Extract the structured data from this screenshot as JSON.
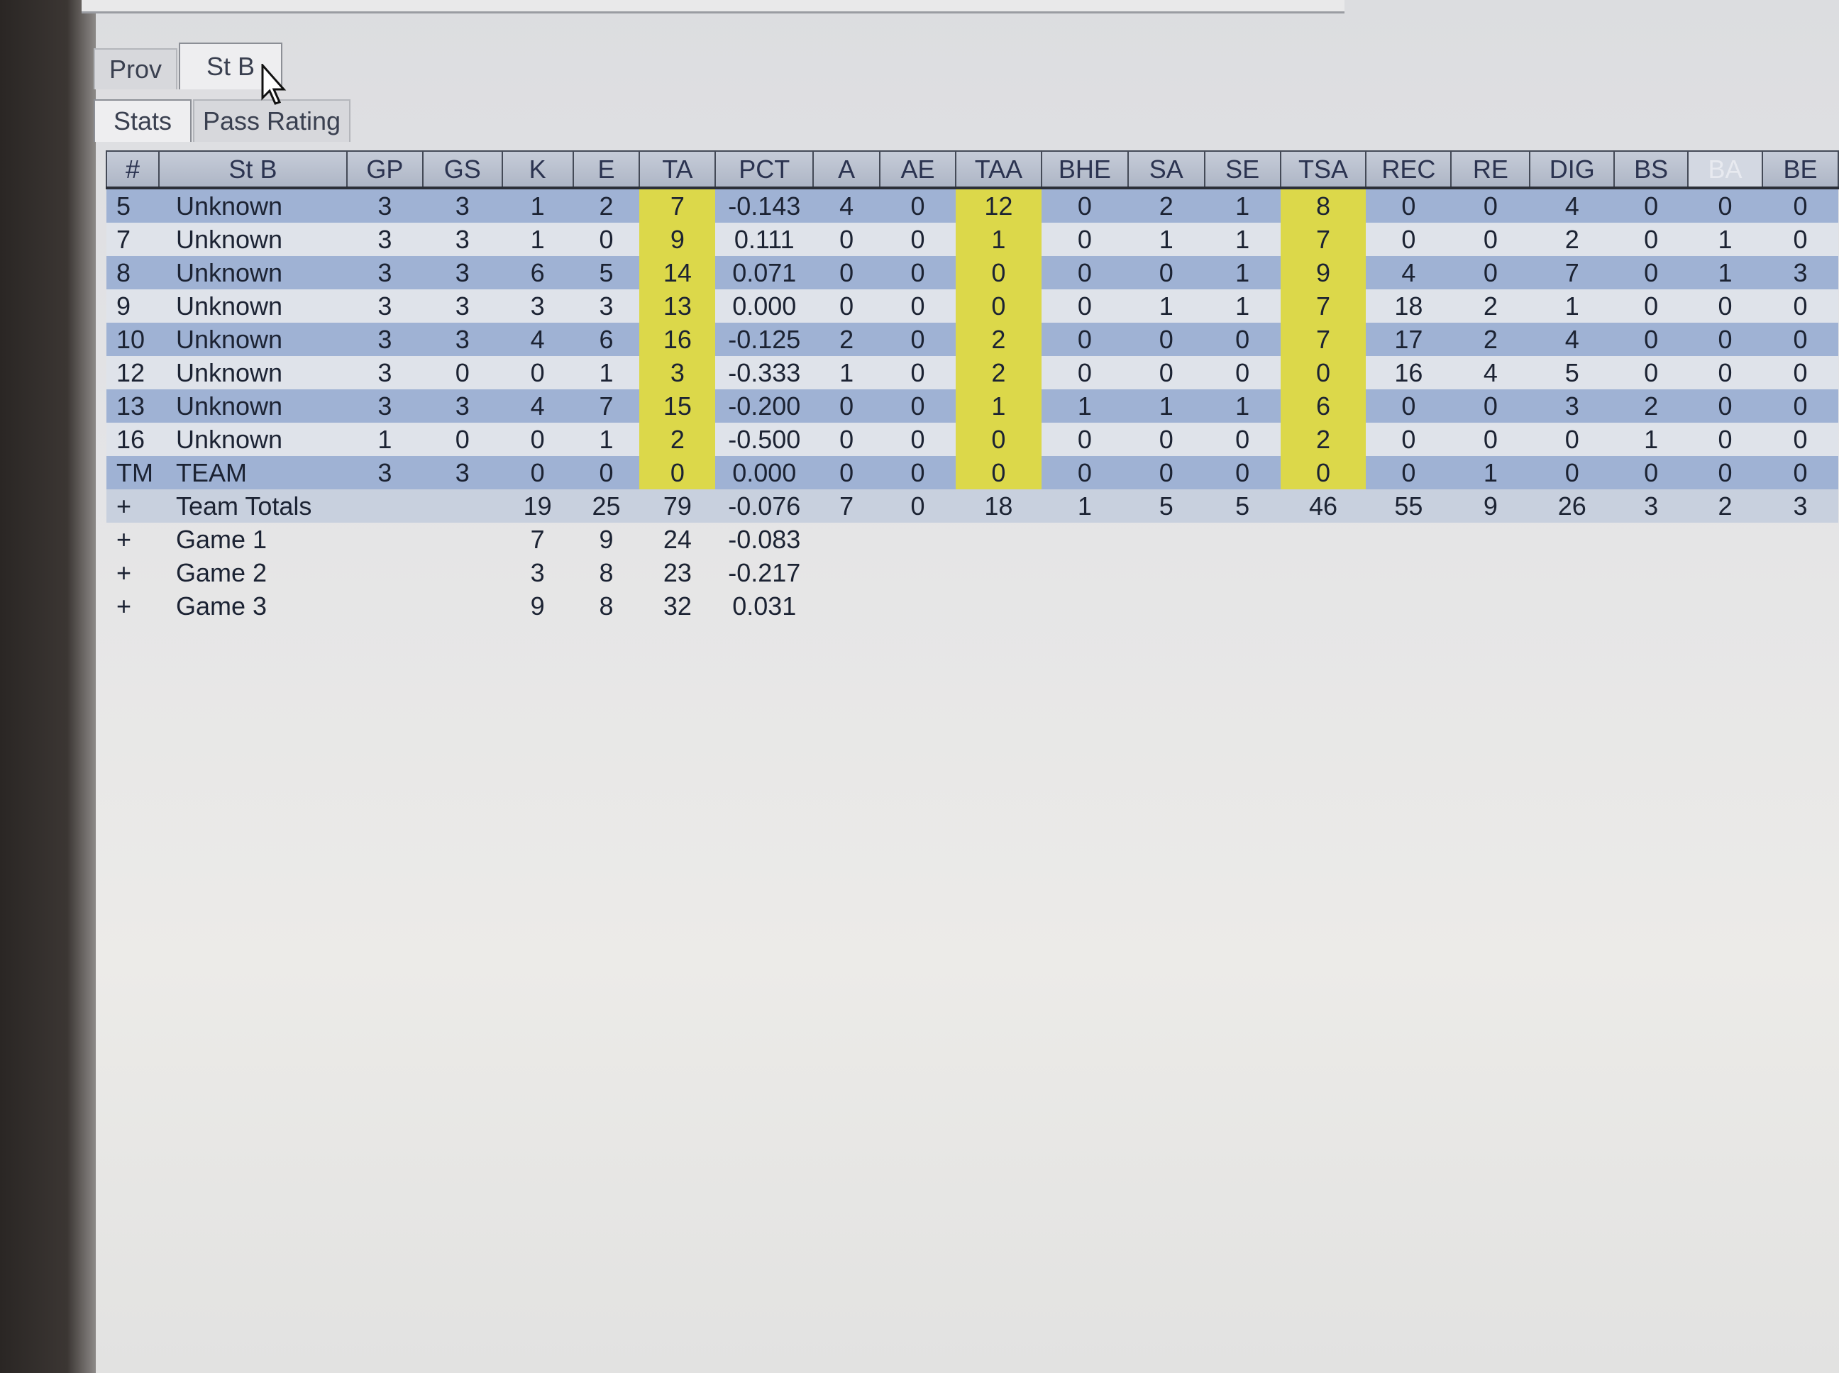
{
  "tabs_top": [
    {
      "label": "Prov",
      "active": false
    },
    {
      "label": "St B",
      "active": true
    }
  ],
  "tabs_sub": [
    {
      "label": "Stats",
      "active": true
    },
    {
      "label": "Pass Rating",
      "active": false
    }
  ],
  "colors": {
    "odd_row": "#9fb2d4",
    "even_row": "#dfe3ea",
    "highlight_column": "#dcd84a"
  },
  "table": {
    "columns": [
      "#",
      "St B",
      "GP",
      "GS",
      "K",
      "E",
      "TA",
      "PCT",
      "A",
      "AE",
      "TAA",
      "BHE",
      "SA",
      "SE",
      "TSA",
      "REC",
      "RE",
      "DIG",
      "BS",
      "BA",
      "BE"
    ],
    "highlight_columns": [
      "TA",
      "TAA",
      "TSA"
    ],
    "rows": [
      [
        "5",
        "Unknown",
        "3",
        "3",
        "1",
        "2",
        "7",
        "-0.143",
        "4",
        "0",
        "12",
        "0",
        "2",
        "1",
        "8",
        "0",
        "0",
        "4",
        "0",
        "0",
        "0"
      ],
      [
        "7",
        "Unknown",
        "3",
        "3",
        "1",
        "0",
        "9",
        "0.111",
        "0",
        "0",
        "1",
        "0",
        "1",
        "1",
        "7",
        "0",
        "0",
        "2",
        "0",
        "1",
        "0"
      ],
      [
        "8",
        "Unknown",
        "3",
        "3",
        "6",
        "5",
        "14",
        "0.071",
        "0",
        "0",
        "0",
        "0",
        "0",
        "1",
        "9",
        "4",
        "0",
        "7",
        "0",
        "1",
        "3"
      ],
      [
        "9",
        "Unknown",
        "3",
        "3",
        "3",
        "3",
        "13",
        "0.000",
        "0",
        "0",
        "0",
        "0",
        "1",
        "1",
        "7",
        "18",
        "2",
        "1",
        "0",
        "0",
        "0"
      ],
      [
        "10",
        "Unknown",
        "3",
        "3",
        "4",
        "6",
        "16",
        "-0.125",
        "2",
        "0",
        "2",
        "0",
        "0",
        "0",
        "7",
        "17",
        "2",
        "4",
        "0",
        "0",
        "0"
      ],
      [
        "12",
        "Unknown",
        "3",
        "0",
        "0",
        "1",
        "3",
        "-0.333",
        "1",
        "0",
        "2",
        "0",
        "0",
        "0",
        "0",
        "16",
        "4",
        "5",
        "0",
        "0",
        "0"
      ],
      [
        "13",
        "Unknown",
        "3",
        "3",
        "4",
        "7",
        "15",
        "-0.200",
        "0",
        "0",
        "1",
        "1",
        "1",
        "1",
        "6",
        "0",
        "0",
        "3",
        "2",
        "0",
        "0"
      ],
      [
        "16",
        "Unknown",
        "1",
        "0",
        "0",
        "1",
        "2",
        "-0.500",
        "0",
        "0",
        "0",
        "0",
        "0",
        "0",
        "2",
        "0",
        "0",
        "0",
        "1",
        "0",
        "0"
      ],
      [
        "TM",
        "TEAM",
        "3",
        "3",
        "0",
        "0",
        "0",
        "0.000",
        "0",
        "0",
        "0",
        "0",
        "0",
        "0",
        "0",
        "0",
        "1",
        "0",
        "0",
        "0",
        "0"
      ]
    ],
    "totals": [
      [
        "+",
        "Team Totals",
        "",
        "",
        "19",
        "25",
        "79",
        "-0.076",
        "7",
        "0",
        "18",
        "1",
        "5",
        "5",
        "46",
        "55",
        "9",
        "26",
        "3",
        "2",
        "3"
      ],
      [
        "+",
        "Game 1",
        "",
        "",
        "7",
        "9",
        "24",
        "-0.083",
        "",
        "",
        "",
        "",
        "",
        "",
        "",
        "",
        "",
        "",
        "",
        "",
        ""
      ],
      [
        "+",
        "Game 2",
        "",
        "",
        "3",
        "8",
        "23",
        "-0.217",
        "",
        "",
        "",
        "",
        "",
        "",
        "",
        "",
        "",
        "",
        "",
        "",
        ""
      ],
      [
        "+",
        "Game 3",
        "",
        "",
        "9",
        "8",
        "32",
        "0.031",
        "",
        "",
        "",
        "",
        "",
        "",
        "",
        "",
        "",
        "",
        "",
        "",
        ""
      ]
    ]
  }
}
